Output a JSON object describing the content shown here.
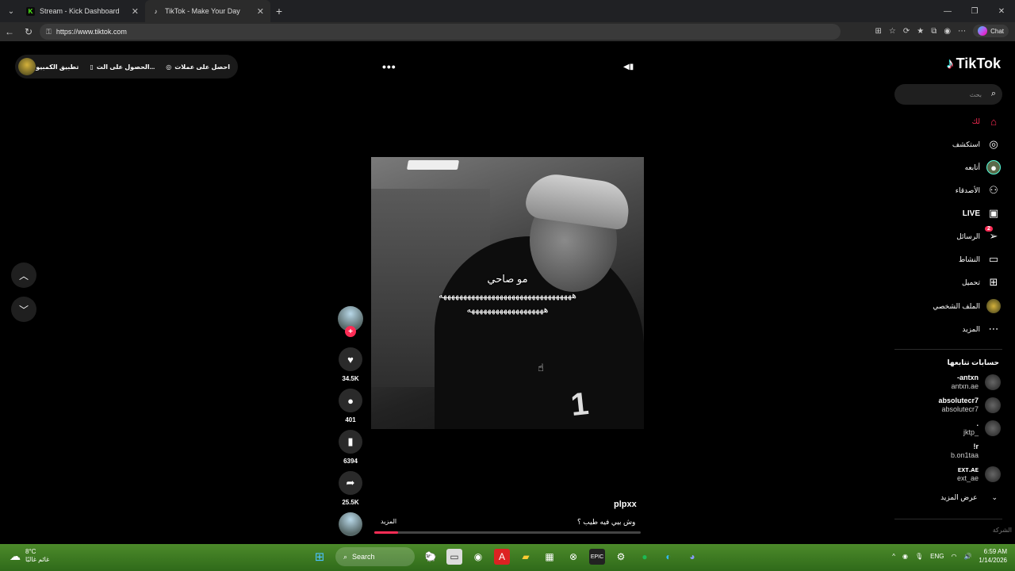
{
  "browser": {
    "tabs": [
      {
        "title": "Stream - Kick Dashboard",
        "favicon": "kick-icon",
        "color": "#53fc18"
      },
      {
        "title": "TikTok - Make Your Day",
        "favicon": "tiktok-icon",
        "color": "#ffffff"
      }
    ],
    "url": "https://www.tiktok.com",
    "chat_label": "Chat"
  },
  "topbar": {
    "get_coins": "احصل على عملات",
    "get_app": "الحصول على الت...",
    "desktop_app": "تطبيق الكمبيوتر"
  },
  "sidebar": {
    "logo": "TikTok",
    "search_placeholder": "بحث",
    "items": [
      {
        "label": "لك",
        "icon": "home-icon"
      },
      {
        "label": "استكشف",
        "icon": "compass-icon"
      },
      {
        "label": "أتابعه",
        "icon": "following-icon"
      },
      {
        "label": "الأصدقاء",
        "icon": "friends-icon"
      },
      {
        "label": "LIVE",
        "icon": "live-icon"
      },
      {
        "label": "الرسائل",
        "icon": "messages-icon",
        "badge": "2"
      },
      {
        "label": "النشاط",
        "icon": "activity-icon"
      },
      {
        "label": "تحميل",
        "icon": "upload-icon"
      },
      {
        "label": "الملف الشخصي",
        "icon": "profile-icon"
      },
      {
        "label": "المزيد",
        "icon": "more-icon"
      }
    ],
    "following_header": "حسابات تتابعها",
    "accounts": [
      {
        "name": "-antxn",
        "handle": "antxn.ae"
      },
      {
        "name": "absolutecr7",
        "handle": "absolutecr7"
      },
      {
        "name": ".",
        "handle": "jktp_"
      },
      {
        "name": "!r",
        "handle": "b.on1taa"
      },
      {
        "name": "ᴇxᴛ.ᴀᴇ",
        "handle": "ext_ae"
      }
    ],
    "see_more": "عرض المزيد",
    "cutoff_text": "الشركة"
  },
  "video": {
    "caption_line1": "مو صاحي",
    "caption_line2": "هههههههههههههههههههههههههههههههههه",
    "caption_line3": "هههههههههههههههههههه",
    "author": "plpxx",
    "description": "وش بيي فيه طيب ؟",
    "more_label": "المزيد",
    "progress_fraction": 0.09
  },
  "actions": {
    "likes": "34.5K",
    "comments": "401",
    "saves": "6394",
    "shares": "25.5K"
  },
  "taskbar": {
    "temp": "8°C",
    "weather_desc": "غائم غالبًا",
    "search_label": "Search",
    "lang": "ENG",
    "time": "6:59 AM",
    "date": "1/14/2026"
  },
  "colors": {
    "accent": "#fe2c55",
    "background": "#000000"
  }
}
